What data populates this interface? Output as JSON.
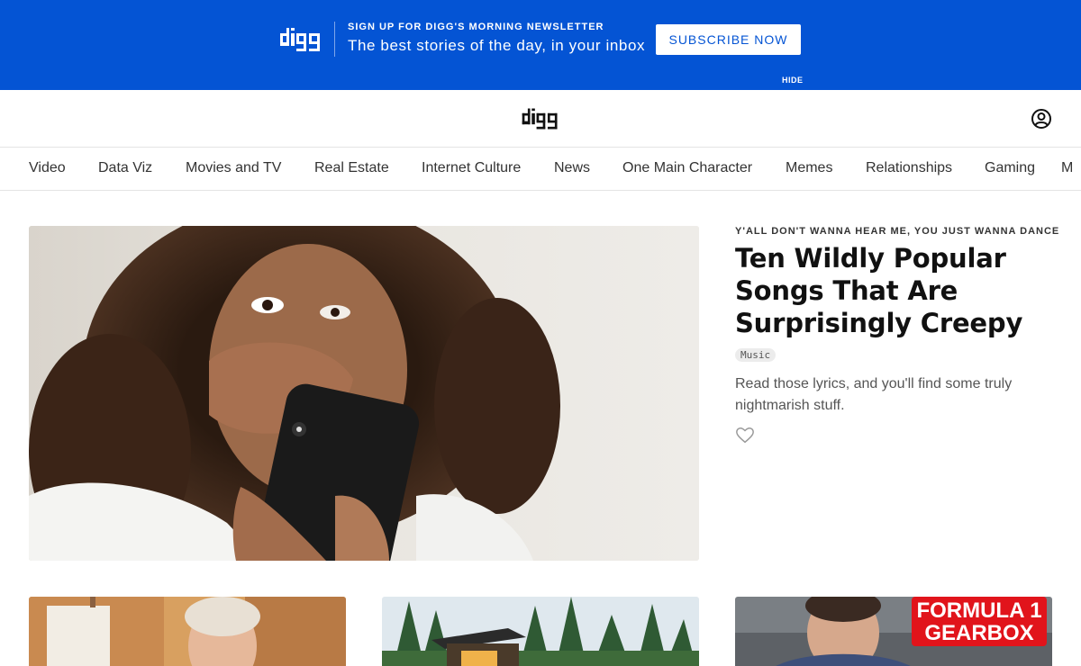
{
  "banner": {
    "kicker": "SIGN UP FOR DIGG'S MORNING NEWSLETTER",
    "pitch": "The best stories of the day, in your inbox",
    "subscribe_label": "SUBSCRIBE NOW",
    "hide_label": "HIDE",
    "logo_text": "digg",
    "bg_color": "#0454d4"
  },
  "header": {
    "logo_text": "digg",
    "user_icon": "user-circle-icon"
  },
  "nav": {
    "items": [
      {
        "label": "Video"
      },
      {
        "label": "Data Viz"
      },
      {
        "label": "Movies and TV"
      },
      {
        "label": "Real Estate"
      },
      {
        "label": "Internet Culture"
      },
      {
        "label": "News"
      },
      {
        "label": "One Main Character"
      },
      {
        "label": "Memes"
      },
      {
        "label": "Relationships"
      },
      {
        "label": "Gaming"
      },
      {
        "label": "M"
      }
    ]
  },
  "hero": {
    "eyebrow": "Y'ALL DON'T WANNA HEAR ME, YOU JUST WANNA DANCE",
    "headline": "Ten Wildly Popular Songs That Are Surprisingly Creepy",
    "tag": "Music",
    "dek": "Read those lyrics, and you'll find some truly nightmarish stuff.",
    "like_icon": "heart-icon"
  },
  "cards": [
    {
      "image": "older-man-photo"
    },
    {
      "image": "forest-cabin-photo"
    },
    {
      "image": "formula1-gearbox-photo",
      "overlay_text": "FORMULA 1 GEARBOX"
    }
  ]
}
